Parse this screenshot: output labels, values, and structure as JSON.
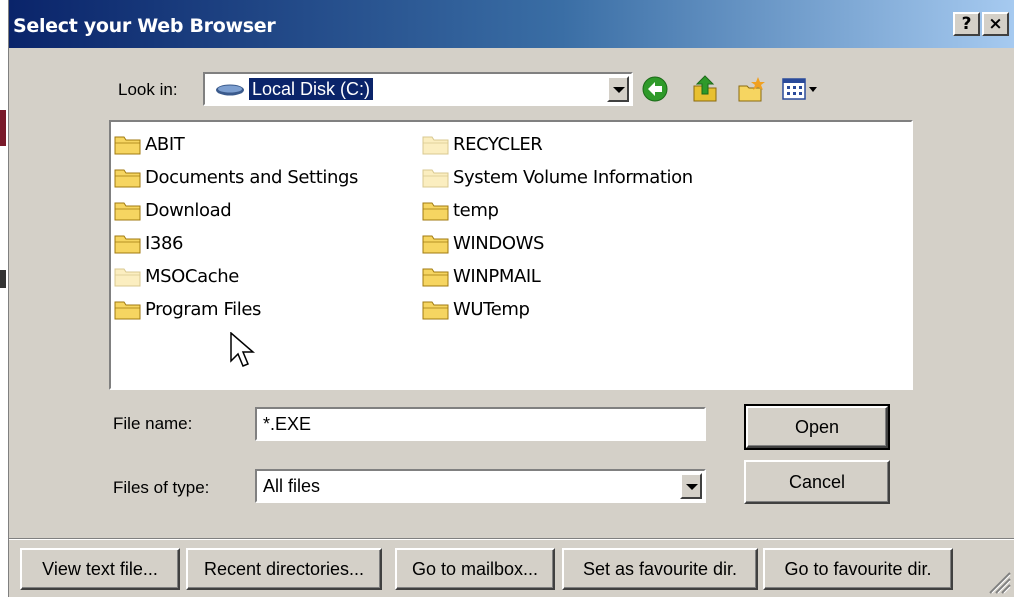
{
  "dialog": {
    "title": "Select your Web Browser",
    "help_button": "?",
    "close_button": "×"
  },
  "look_in": {
    "label": "Look in:",
    "value": "Local Disk (C:)"
  },
  "toolbar_icons": [
    "back-icon",
    "up-folder-icon",
    "new-folder-icon",
    "view-menu-icon"
  ],
  "files": {
    "column1": [
      {
        "name": "ABIT",
        "hidden": false
      },
      {
        "name": "Documents and Settings",
        "hidden": false
      },
      {
        "name": "Download",
        "hidden": false
      },
      {
        "name": "I386",
        "hidden": false
      },
      {
        "name": "MSOCache",
        "hidden": true
      },
      {
        "name": "Program Files",
        "hidden": false
      }
    ],
    "column2": [
      {
        "name": "RECYCLER",
        "hidden": true
      },
      {
        "name": "System Volume Information",
        "hidden": true
      },
      {
        "name": "temp",
        "hidden": false
      },
      {
        "name": "WINDOWS",
        "hidden": false
      },
      {
        "name": "WINPMAIL",
        "hidden": false
      },
      {
        "name": "WUTemp",
        "hidden": false
      }
    ]
  },
  "file_name": {
    "label": "File name:",
    "value": "*.EXE"
  },
  "files_of_type": {
    "label": "Files of type:",
    "value": "All files"
  },
  "buttons": {
    "open": "Open",
    "cancel": "Cancel"
  },
  "bottom_buttons": [
    "View text file...",
    "Recent directories...",
    "Go to mailbox...",
    "Set as favourite dir.",
    "Go to favourite dir."
  ],
  "colors": {
    "title_gradient_start": "#0a246a",
    "title_gradient_end": "#a6caf0",
    "face": "#d4d0c8",
    "folder_yellow": "#f6d561",
    "selection": "#0a246a"
  }
}
